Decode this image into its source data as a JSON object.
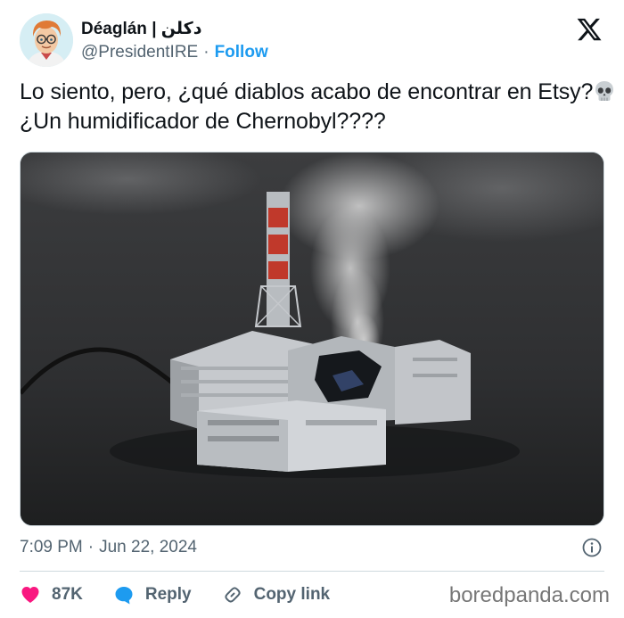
{
  "author": {
    "display_name": "Déaglán | دكلن",
    "handle": "@PresidentIRE",
    "separator": "·",
    "follow_label": "Follow"
  },
  "tweet": {
    "text_before_emoji": "Lo siento, pero, ¿qué diablos acabo de encontrar en Etsy?",
    "emoji": "skull-icon",
    "text_after_emoji": " ¿Un humidificador de Chernobyl????"
  },
  "meta": {
    "time": "7:09 PM",
    "separator": "·",
    "date": "Jun 22, 2024"
  },
  "actions": {
    "likes": "87K",
    "reply_label": "Reply",
    "copy_link_label": "Copy link"
  },
  "watermark": "boredpanda.com",
  "colors": {
    "accent": "#1d9bf0",
    "like": "#f91880",
    "muted": "#536471"
  }
}
